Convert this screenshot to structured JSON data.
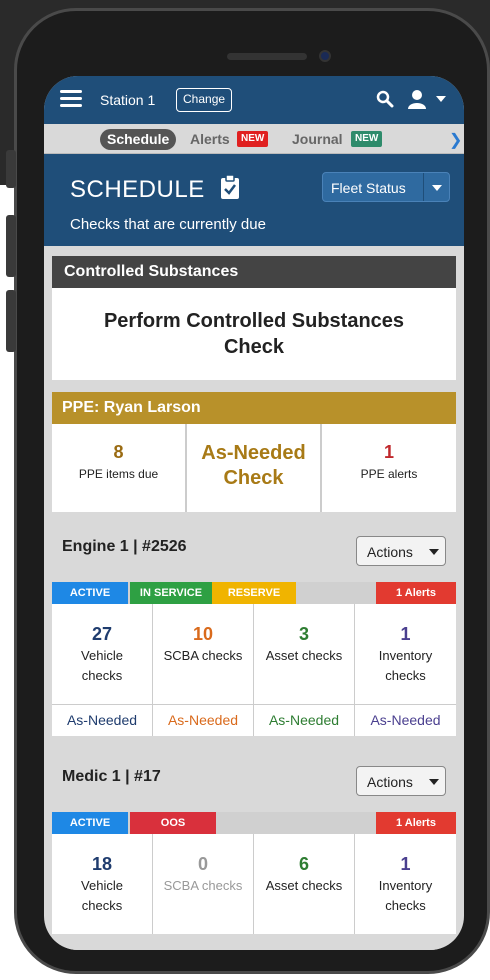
{
  "topbar": {
    "station": "Station 1",
    "change_label": "Change"
  },
  "tabs": {
    "schedule": "Schedule",
    "alerts": "Alerts",
    "alerts_badge": "NEW",
    "journal": "Journal",
    "journal_badge": "NEW"
  },
  "header": {
    "title": "SCHEDULE",
    "subtitle": "Checks that are currently due",
    "fleet_status": "Fleet Status"
  },
  "controlled": {
    "title": "Controlled Substances",
    "action_line1": "Perform Controlled Substances",
    "action_line2": "Check"
  },
  "ppe": {
    "title": "PPE: Ryan Larson",
    "items_due_count": "8",
    "items_due_label": "PPE items due",
    "asneeded_line1": "As-Needed",
    "asneeded_line2": "Check",
    "alerts_count": "1",
    "alerts_label": "PPE alerts"
  },
  "vehicles": [
    {
      "title": "Engine 1 | #2526",
      "actions": "Actions",
      "status": {
        "active": "ACTIVE",
        "service": "IN SERVICE",
        "reserve": "RESERVE",
        "alerts": "1 Alerts"
      },
      "metrics": [
        {
          "num": "27",
          "line1": "Vehicle",
          "line2": "checks",
          "asneeded": "As-Needed"
        },
        {
          "num": "10",
          "line1": "SCBA checks",
          "line2": "",
          "asneeded": "As-Needed"
        },
        {
          "num": "3",
          "line1": "Asset checks",
          "line2": "",
          "asneeded": "As-Needed"
        },
        {
          "num": "1",
          "line1": "Inventory",
          "line2": "checks",
          "asneeded": "As-Needed"
        }
      ]
    },
    {
      "title": "Medic 1 | #17",
      "actions": "Actions",
      "status": {
        "active": "ACTIVE",
        "oos": "OOS",
        "alerts": "1 Alerts"
      },
      "metrics": [
        {
          "num": "18",
          "line1": "Vehicle",
          "line2": "checks"
        },
        {
          "num": "0",
          "line1": "SCBA checks",
          "line2": ""
        },
        {
          "num": "6",
          "line1": "Asset checks",
          "line2": ""
        },
        {
          "num": "1",
          "line1": "Inventory",
          "line2": "checks"
        }
      ]
    }
  ],
  "colors": {
    "navy": "#1f4e79",
    "ppe_gold": "#b8912a",
    "active_blue": "#1e88e5",
    "service_green": "#2ea043",
    "reserve_yellow": "#f0b400",
    "oos_red": "#d9303c"
  },
  "icons": [
    "hamburger-icon",
    "search-icon",
    "user-icon",
    "caret-down-icon",
    "chevron-right-icon",
    "clipboard-check-icon"
  ]
}
